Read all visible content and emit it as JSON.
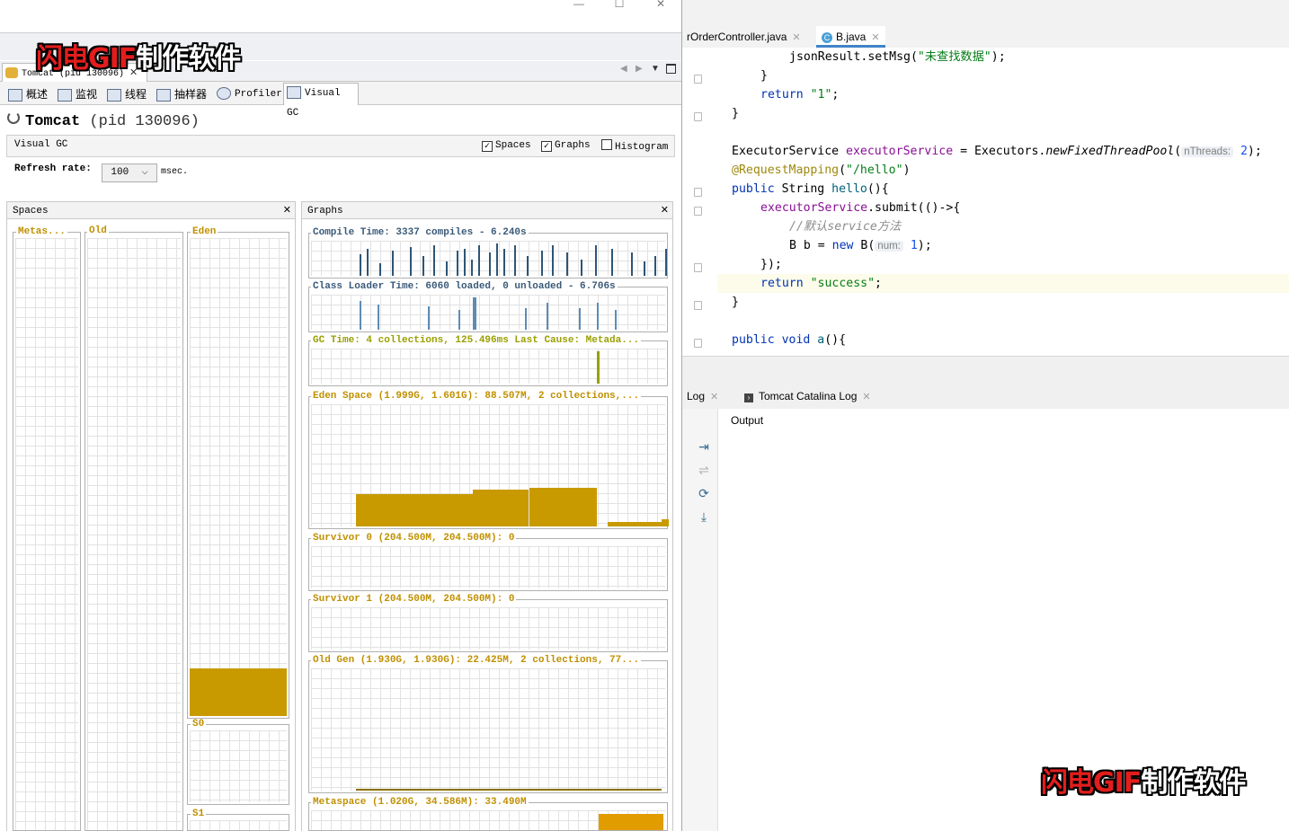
{
  "watermark": {
    "part_red": "闪电GIF",
    "part_white": "制作软件"
  },
  "visualvm": {
    "document_tab": "Tomcat (pid 130096)",
    "sub_tabs": [
      "概述",
      "监视",
      "线程",
      "抽样器",
      "Profiler",
      "Visual GC"
    ],
    "process_name": "Tomcat",
    "process_pid": "(pid 130096)",
    "view_label": "Visual GC",
    "checkboxes": {
      "spaces": "Spaces",
      "graphs": "Graphs",
      "histogram": "Histogram"
    },
    "refresh_label": "Refresh rate:",
    "refresh_value": "100",
    "refresh_unit": "msec.",
    "spaces_panel": {
      "title": "Spaces",
      "metaspace": "Metas...",
      "old": "Old",
      "eden": "Eden",
      "s0": "S0",
      "s1": "S1",
      "eden_fill": 0.1
    },
    "graphs_panel": {
      "title": "Graphs",
      "compile_time": "Compile Time: 3337 compiles - 6.240s",
      "class_loader": "Class Loader Time: 6060 loaded, 0 unloaded - 6.706s",
      "gc_time": "GC Time: 4 collections, 125.496ms Last Cause: Metada...",
      "eden_space": "Eden Space (1.999G, 1.601G): 88.507M, 2 collections,...",
      "survivor0": "Survivor 0 (204.500M, 204.500M): 0",
      "survivor1": "Survivor 1 (204.500M, 204.500M): 0",
      "old_gen": "Old Gen (1.930G, 1.930G): 22.425M, 2 collections, 77...",
      "metaspace": "Metaspace (1.020G, 34.586M): 33.490M"
    }
  },
  "ide": {
    "tabs": [
      {
        "label": "rOrderController.java"
      },
      {
        "label": "B.java",
        "icon": "C"
      }
    ],
    "code": {
      "l1a": "jsonResult.setMsg(",
      "l1b": "\"未查找数据\"",
      "l1c": ");",
      "l2": "}",
      "l3a": "return ",
      "l3b": "\"1\"",
      "l3c": ";",
      "l4": "}",
      "l6a": "ExecutorService ",
      "l6b": "executorService",
      "l6c": " = Executors.",
      "l6d": "newFixedThreadPool",
      "l6e": "(",
      "l6hint": "nThreads:",
      "l6f": " 2",
      "l6g": ");",
      "l7a": "@RequestMapping",
      "l7b": "(",
      "l7c": "\"/hello\"",
      "l7d": ")",
      "l8a": "public ",
      "l8b": "String ",
      "l8c": "hello",
      "l8d": "(){",
      "l9a": "executorService",
      "l9b": ".submit(()->{",
      "l10": "//默认service方法",
      "l11a": "B b = ",
      "l11b": "new ",
      "l11c": "B(",
      "l11hint": "num:",
      "l11d": " 1",
      "l11e": ");",
      "l12": "});",
      "l13a": "return ",
      "l13b": "\"success\"",
      "l13c": ";",
      "l14": "}",
      "l16a": "public void ",
      "l16b": "a",
      "l16c": "(){"
    },
    "log_tabs": [
      {
        "label": "Log"
      },
      {
        "label": "Tomcat Catalina Log"
      }
    ],
    "output_label": "Output"
  }
}
